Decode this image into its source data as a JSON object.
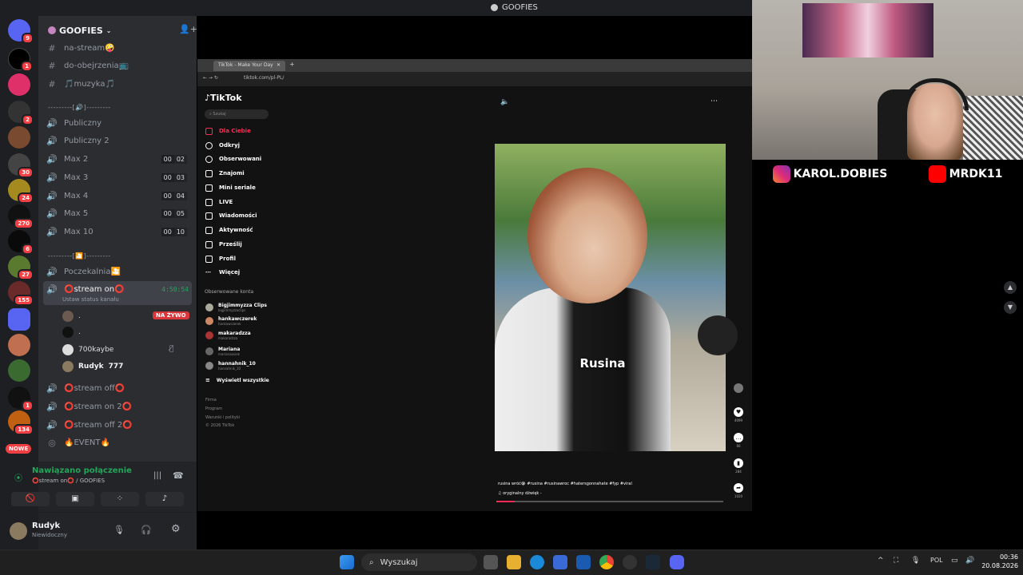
{
  "discord": {
    "server_name": "GOOFIES",
    "window_title": "GOOFIES",
    "badges": [
      "9",
      "1",
      "2",
      "30",
      "24",
      "270",
      "6",
      "27",
      "155",
      "1",
      "134"
    ],
    "new_label": "NOWE",
    "text_channels": [
      {
        "name": "na-stream🤪"
      },
      {
        "name": "do-obejrzenia📺"
      },
      {
        "name": "🎵muzyka🎵"
      }
    ],
    "separator1": "---------[🔊]---------",
    "voice_channels": [
      {
        "name": "Publiczny",
        "a": "",
        "b": ""
      },
      {
        "name": "Publiczny 2",
        "a": "",
        "b": ""
      },
      {
        "name": "Max 2",
        "a": "00",
        "b": "02"
      },
      {
        "name": "Max 3",
        "a": "00",
        "b": "03"
      },
      {
        "name": "Max 4",
        "a": "00",
        "b": "04"
      },
      {
        "name": "Max 5",
        "a": "00",
        "b": "05"
      },
      {
        "name": "Max 10",
        "a": "00",
        "b": "10"
      }
    ],
    "separator2": "---------[🎦]---------",
    "waiting_room": "Poczekalnia🎦",
    "active_channel": {
      "name": "⭕stream on⭕",
      "timer": "4:50:54",
      "status": "Ustaw status kanału"
    },
    "users": [
      {
        "name": ".",
        "tag": "NA ŻYWO"
      },
      {
        "name": "."
      },
      {
        "name": "700kaybe"
      },
      {
        "name": "Rudyk",
        "extra": "777"
      }
    ],
    "more_channels": [
      {
        "name": "⭕stream off⭕"
      },
      {
        "name": "⭕stream on 2⭕"
      },
      {
        "name": "⭕stream off 2⭕"
      },
      {
        "name": "🔥EVENT🔥"
      }
    ],
    "voice_status": {
      "title": "Nawiązano połączenie",
      "sub": "⭕stream on⭕ / GOOFIES"
    },
    "user_panel": {
      "name": "Rudyk",
      "status": "Niewidoczny"
    }
  },
  "browser": {
    "tab_title": "TikTok - Make Your Day",
    "url": "tiktok.com/pl-PL/"
  },
  "tiktok": {
    "logo": "TikTok",
    "search_placeholder": "Szukaj",
    "nav": [
      "Dla Ciebie",
      "Odkryj",
      "Obserwowani",
      "Znajomi",
      "Mini seriale",
      "LIVE",
      "Wiadomości",
      "Aktywność",
      "Prześlij",
      "Profil",
      "Więcej"
    ],
    "followed_header": "Obserwowane konta",
    "accounts": [
      {
        "name": "Bigjimmyzza Clips",
        "handle": "bigjimmyzzaclips"
      },
      {
        "name": "hankawczerek",
        "handle": "hankawczerek"
      },
      {
        "name": "makaradzza",
        "handle": "makaradzza"
      },
      {
        "name": "Mariana",
        "handle": "marianaasiek"
      },
      {
        "name": "hannahnik_10",
        "handle": "hannahnik_10"
      }
    ],
    "show_all": "Wyświetl wszystkie",
    "footer": [
      "Firma",
      "Program",
      "Warunki i polityki",
      "© 2026 TikTok"
    ],
    "video_caption": "Rusina",
    "description": "rusina wróć😭 #rusina #rusinawroc #hatersgonnahate #fyp #viral",
    "sound": "oryginalny dźwięk -",
    "likes": "4099",
    "comments": "66",
    "saves": "284",
    "shares": "1020"
  },
  "overlay": {
    "instagram": "KAROL.DOBIES",
    "youtube": "MRDK11"
  },
  "taskbar": {
    "search": "Wyszukaj",
    "lang": "POL",
    "time": "00:36",
    "date": "20.08.2026"
  }
}
